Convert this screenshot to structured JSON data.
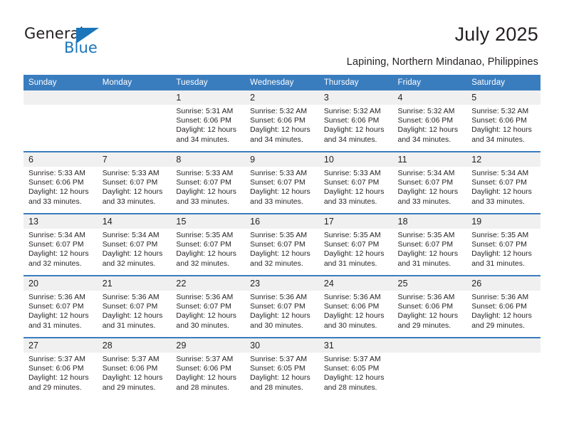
{
  "brand": {
    "name_part1": "General",
    "name_part2": "Blue",
    "accent_color": "#1b75bb"
  },
  "header": {
    "title": "July 2025",
    "subtitle": "Lapining, Northern Mindanao, Philippines"
  },
  "theme": {
    "header_blue": "#3a7dbf",
    "daynum_band": "#f0f0f0",
    "text": "#231f20"
  },
  "calendar": {
    "weekday_headers": [
      "Sunday",
      "Monday",
      "Tuesday",
      "Wednesday",
      "Thursday",
      "Friday",
      "Saturday"
    ],
    "weeks": [
      {
        "days": [
          {
            "num": "",
            "sunrise": "",
            "sunset": "",
            "daylight_line1": "",
            "daylight_line2": ""
          },
          {
            "num": "",
            "sunrise": "",
            "sunset": "",
            "daylight_line1": "",
            "daylight_line2": ""
          },
          {
            "num": "1",
            "sunrise": "Sunrise: 5:31 AM",
            "sunset": "Sunset: 6:06 PM",
            "daylight_line1": "Daylight: 12 hours",
            "daylight_line2": "and 34 minutes."
          },
          {
            "num": "2",
            "sunrise": "Sunrise: 5:32 AM",
            "sunset": "Sunset: 6:06 PM",
            "daylight_line1": "Daylight: 12 hours",
            "daylight_line2": "and 34 minutes."
          },
          {
            "num": "3",
            "sunrise": "Sunrise: 5:32 AM",
            "sunset": "Sunset: 6:06 PM",
            "daylight_line1": "Daylight: 12 hours",
            "daylight_line2": "and 34 minutes."
          },
          {
            "num": "4",
            "sunrise": "Sunrise: 5:32 AM",
            "sunset": "Sunset: 6:06 PM",
            "daylight_line1": "Daylight: 12 hours",
            "daylight_line2": "and 34 minutes."
          },
          {
            "num": "5",
            "sunrise": "Sunrise: 5:32 AM",
            "sunset": "Sunset: 6:06 PM",
            "daylight_line1": "Daylight: 12 hours",
            "daylight_line2": "and 34 minutes."
          }
        ]
      },
      {
        "days": [
          {
            "num": "6",
            "sunrise": "Sunrise: 5:33 AM",
            "sunset": "Sunset: 6:06 PM",
            "daylight_line1": "Daylight: 12 hours",
            "daylight_line2": "and 33 minutes."
          },
          {
            "num": "7",
            "sunrise": "Sunrise: 5:33 AM",
            "sunset": "Sunset: 6:07 PM",
            "daylight_line1": "Daylight: 12 hours",
            "daylight_line2": "and 33 minutes."
          },
          {
            "num": "8",
            "sunrise": "Sunrise: 5:33 AM",
            "sunset": "Sunset: 6:07 PM",
            "daylight_line1": "Daylight: 12 hours",
            "daylight_line2": "and 33 minutes."
          },
          {
            "num": "9",
            "sunrise": "Sunrise: 5:33 AM",
            "sunset": "Sunset: 6:07 PM",
            "daylight_line1": "Daylight: 12 hours",
            "daylight_line2": "and 33 minutes."
          },
          {
            "num": "10",
            "sunrise": "Sunrise: 5:33 AM",
            "sunset": "Sunset: 6:07 PM",
            "daylight_line1": "Daylight: 12 hours",
            "daylight_line2": "and 33 minutes."
          },
          {
            "num": "11",
            "sunrise": "Sunrise: 5:34 AM",
            "sunset": "Sunset: 6:07 PM",
            "daylight_line1": "Daylight: 12 hours",
            "daylight_line2": "and 33 minutes."
          },
          {
            "num": "12",
            "sunrise": "Sunrise: 5:34 AM",
            "sunset": "Sunset: 6:07 PM",
            "daylight_line1": "Daylight: 12 hours",
            "daylight_line2": "and 33 minutes."
          }
        ]
      },
      {
        "days": [
          {
            "num": "13",
            "sunrise": "Sunrise: 5:34 AM",
            "sunset": "Sunset: 6:07 PM",
            "daylight_line1": "Daylight: 12 hours",
            "daylight_line2": "and 32 minutes."
          },
          {
            "num": "14",
            "sunrise": "Sunrise: 5:34 AM",
            "sunset": "Sunset: 6:07 PM",
            "daylight_line1": "Daylight: 12 hours",
            "daylight_line2": "and 32 minutes."
          },
          {
            "num": "15",
            "sunrise": "Sunrise: 5:35 AM",
            "sunset": "Sunset: 6:07 PM",
            "daylight_line1": "Daylight: 12 hours",
            "daylight_line2": "and 32 minutes."
          },
          {
            "num": "16",
            "sunrise": "Sunrise: 5:35 AM",
            "sunset": "Sunset: 6:07 PM",
            "daylight_line1": "Daylight: 12 hours",
            "daylight_line2": "and 32 minutes."
          },
          {
            "num": "17",
            "sunrise": "Sunrise: 5:35 AM",
            "sunset": "Sunset: 6:07 PM",
            "daylight_line1": "Daylight: 12 hours",
            "daylight_line2": "and 31 minutes."
          },
          {
            "num": "18",
            "sunrise": "Sunrise: 5:35 AM",
            "sunset": "Sunset: 6:07 PM",
            "daylight_line1": "Daylight: 12 hours",
            "daylight_line2": "and 31 minutes."
          },
          {
            "num": "19",
            "sunrise": "Sunrise: 5:35 AM",
            "sunset": "Sunset: 6:07 PM",
            "daylight_line1": "Daylight: 12 hours",
            "daylight_line2": "and 31 minutes."
          }
        ]
      },
      {
        "days": [
          {
            "num": "20",
            "sunrise": "Sunrise: 5:36 AM",
            "sunset": "Sunset: 6:07 PM",
            "daylight_line1": "Daylight: 12 hours",
            "daylight_line2": "and 31 minutes."
          },
          {
            "num": "21",
            "sunrise": "Sunrise: 5:36 AM",
            "sunset": "Sunset: 6:07 PM",
            "daylight_line1": "Daylight: 12 hours",
            "daylight_line2": "and 31 minutes."
          },
          {
            "num": "22",
            "sunrise": "Sunrise: 5:36 AM",
            "sunset": "Sunset: 6:07 PM",
            "daylight_line1": "Daylight: 12 hours",
            "daylight_line2": "and 30 minutes."
          },
          {
            "num": "23",
            "sunrise": "Sunrise: 5:36 AM",
            "sunset": "Sunset: 6:07 PM",
            "daylight_line1": "Daylight: 12 hours",
            "daylight_line2": "and 30 minutes."
          },
          {
            "num": "24",
            "sunrise": "Sunrise: 5:36 AM",
            "sunset": "Sunset: 6:06 PM",
            "daylight_line1": "Daylight: 12 hours",
            "daylight_line2": "and 30 minutes."
          },
          {
            "num": "25",
            "sunrise": "Sunrise: 5:36 AM",
            "sunset": "Sunset: 6:06 PM",
            "daylight_line1": "Daylight: 12 hours",
            "daylight_line2": "and 29 minutes."
          },
          {
            "num": "26",
            "sunrise": "Sunrise: 5:36 AM",
            "sunset": "Sunset: 6:06 PM",
            "daylight_line1": "Daylight: 12 hours",
            "daylight_line2": "and 29 minutes."
          }
        ]
      },
      {
        "days": [
          {
            "num": "27",
            "sunrise": "Sunrise: 5:37 AM",
            "sunset": "Sunset: 6:06 PM",
            "daylight_line1": "Daylight: 12 hours",
            "daylight_line2": "and 29 minutes."
          },
          {
            "num": "28",
            "sunrise": "Sunrise: 5:37 AM",
            "sunset": "Sunset: 6:06 PM",
            "daylight_line1": "Daylight: 12 hours",
            "daylight_line2": "and 29 minutes."
          },
          {
            "num": "29",
            "sunrise": "Sunrise: 5:37 AM",
            "sunset": "Sunset: 6:06 PM",
            "daylight_line1": "Daylight: 12 hours",
            "daylight_line2": "and 28 minutes."
          },
          {
            "num": "30",
            "sunrise": "Sunrise: 5:37 AM",
            "sunset": "Sunset: 6:05 PM",
            "daylight_line1": "Daylight: 12 hours",
            "daylight_line2": "and 28 minutes."
          },
          {
            "num": "31",
            "sunrise": "Sunrise: 5:37 AM",
            "sunset": "Sunset: 6:05 PM",
            "daylight_line1": "Daylight: 12 hours",
            "daylight_line2": "and 28 minutes."
          },
          {
            "num": "",
            "sunrise": "",
            "sunset": "",
            "daylight_line1": "",
            "daylight_line2": ""
          },
          {
            "num": "",
            "sunrise": "",
            "sunset": "",
            "daylight_line1": "",
            "daylight_line2": ""
          }
        ]
      }
    ]
  }
}
